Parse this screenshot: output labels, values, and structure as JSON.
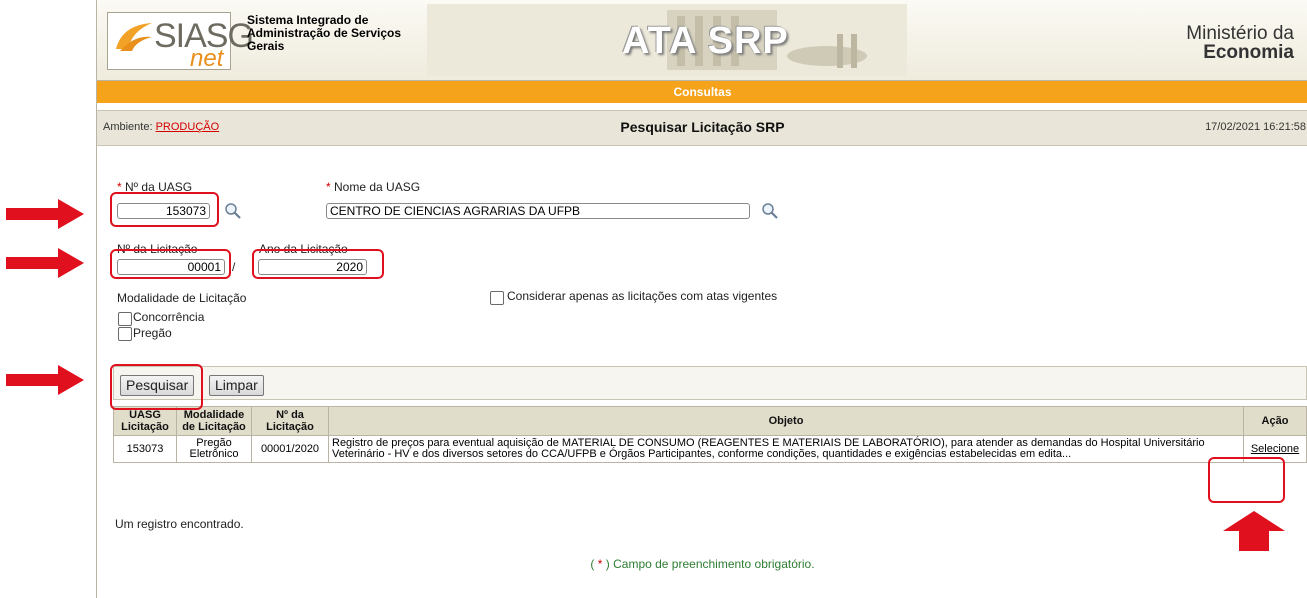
{
  "header": {
    "logo_main": "SIASG",
    "logo_sub": "net",
    "system_name": "Sistema Integrado de Administração de Serviços Gerais",
    "banner_title": "ATA SRP",
    "ministry_line1": "Ministério da",
    "ministry_line2": "Economia"
  },
  "menu": {
    "label": "Consultas"
  },
  "infobar": {
    "ambiente_label": "Ambiente:",
    "ambiente_value": "PRODUÇÃO",
    "title": "Pesquisar Licitação SRP",
    "datetime": "17/02/2021 16:21:58"
  },
  "form": {
    "required_mark": "*",
    "uasg_number_label": "Nº da UASG",
    "uasg_number_value": "153073",
    "uasg_name_label": "Nome da UASG",
    "uasg_name_value": "CENTRO DE CIENCIAS AGRARIAS DA UFPB",
    "licitacao_number_label": "Nº da Licitação",
    "licitacao_number_value": "00001",
    "separator": "/",
    "licitacao_year_label": "Ano da Licitação",
    "licitacao_year_value": "2020",
    "modalidade_label": "Modalidade de Licitação",
    "modalidade_options": [
      "Concorrência",
      "Pregão"
    ],
    "vigentes_label": "Considerar apenas as licitações com atas vigentes"
  },
  "buttons": {
    "search": "Pesquisar",
    "clear": "Limpar"
  },
  "results": {
    "headers": {
      "uasg": "UASG Licitação",
      "modalidade": "Modalidade de Licitação",
      "numero": "Nº da Licitação",
      "objeto": "Objeto",
      "acao": "Ação"
    },
    "rows": [
      {
        "uasg": "153073",
        "modalidade": "Pregão Eletrônico",
        "numero": "00001/2020",
        "objeto": "Registro de preços para eventual aquisição de MATERIAL DE CONSUMO (REAGENTES E MATERIAIS DE LABORATÓRIO), para atender as demandas do Hospital Universitário Veterinário - HV e dos diversos setores do CCA/UFPB e Órgãos Participantes, conforme condições, quantidades e exigências estabelecidas em edita...",
        "acao": "Selecione"
      }
    ],
    "count_text": "Um registro encontrado."
  },
  "footnote": {
    "prefix": "( ",
    "mark": "*",
    "text": " ) Campo de preenchimento obrigatório."
  },
  "colors": {
    "accent_orange": "#f5a31a",
    "annotation_red": "#e0101e",
    "required_red": "#d30000"
  }
}
